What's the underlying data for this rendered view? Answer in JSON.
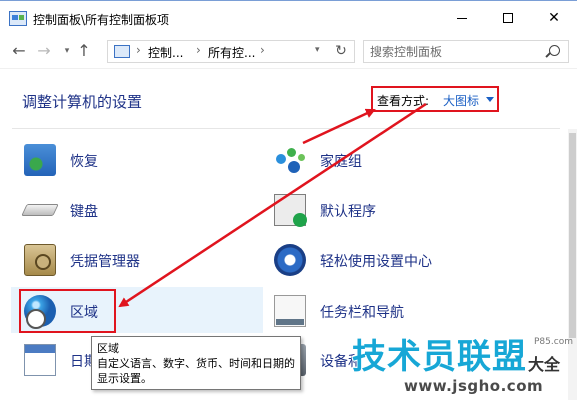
{
  "window": {
    "title": "控制面板\\所有控制面板项"
  },
  "address": {
    "crumbs": [
      "控制...",
      "所有控..."
    ],
    "search_placeholder": "搜索控制面板"
  },
  "header": {
    "title": "调整计算机的设置",
    "view_by_label": "查看方式:",
    "view_by_value": "大图标"
  },
  "items": {
    "recovery": "恢复",
    "homegroup": "家庭组",
    "keyboard": "键盘",
    "default_programs": "默认程序",
    "credential_manager": "凭据管理器",
    "ease_of_access": "轻松使用设置中心",
    "region": "区域",
    "taskbar": "任务栏和导航",
    "date_time": "日期",
    "devices": "设备和"
  },
  "tooltip": {
    "title": "区域",
    "description": "自定义语言、数字、货币、时间和日期的显示设置。"
  },
  "watermark": {
    "main": "技术员联盟",
    "sub": "大全",
    "small": "P85.com",
    "url": "www.jsgho.com"
  },
  "colors": {
    "link_blue": "#1e3287",
    "annotation_red": "#e0141e",
    "dropdown_blue": "#1a5fc4"
  },
  "icons": {
    "search": "search-icon",
    "refresh": "refresh-icon",
    "back": "back-arrow-icon",
    "forward": "forward-arrow-icon",
    "up": "up-arrow-icon"
  }
}
